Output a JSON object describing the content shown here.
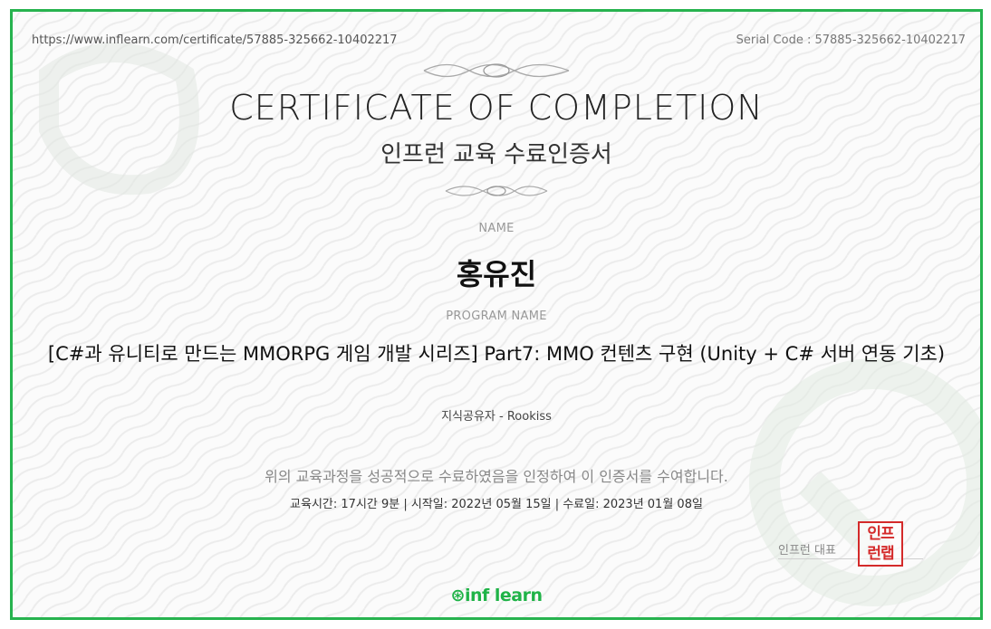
{
  "certificate": {
    "url": "https://www.inflearn.com/certificate/57885-325662-10402217",
    "serial": "Serial Code : 57885-325662-10402217",
    "title": "CERTIFICATE OF COMPLETION",
    "subtitle": "인프런 교육 수료인증서",
    "name_label": "NAME",
    "name": "홍유진",
    "program_label": "PROGRAM NAME",
    "program": "[C#과 유니티로 만드는 MMORPG 게임 개발 시리즈] Part7: MMO 컨텐츠 구현 (Unity + C# 서버 연동 기초)",
    "instructor": "지식공유자 - Rookiss",
    "statement": "위의 교육과정을 성공적으로 수료하였음을 인정하여 이 인증서를 수여합니다.",
    "period": "교육시간: 17시간 9분 | 시작일: 2022년 05월 15일 | 수료일: 2023년 01월 08일",
    "representative": "인프런 대표",
    "seal_text": "인프런랩",
    "logo": "inf learn"
  },
  "colors": {
    "frame": "#27b34f",
    "seal": "#d42a2a",
    "logo": "#1fb347"
  }
}
